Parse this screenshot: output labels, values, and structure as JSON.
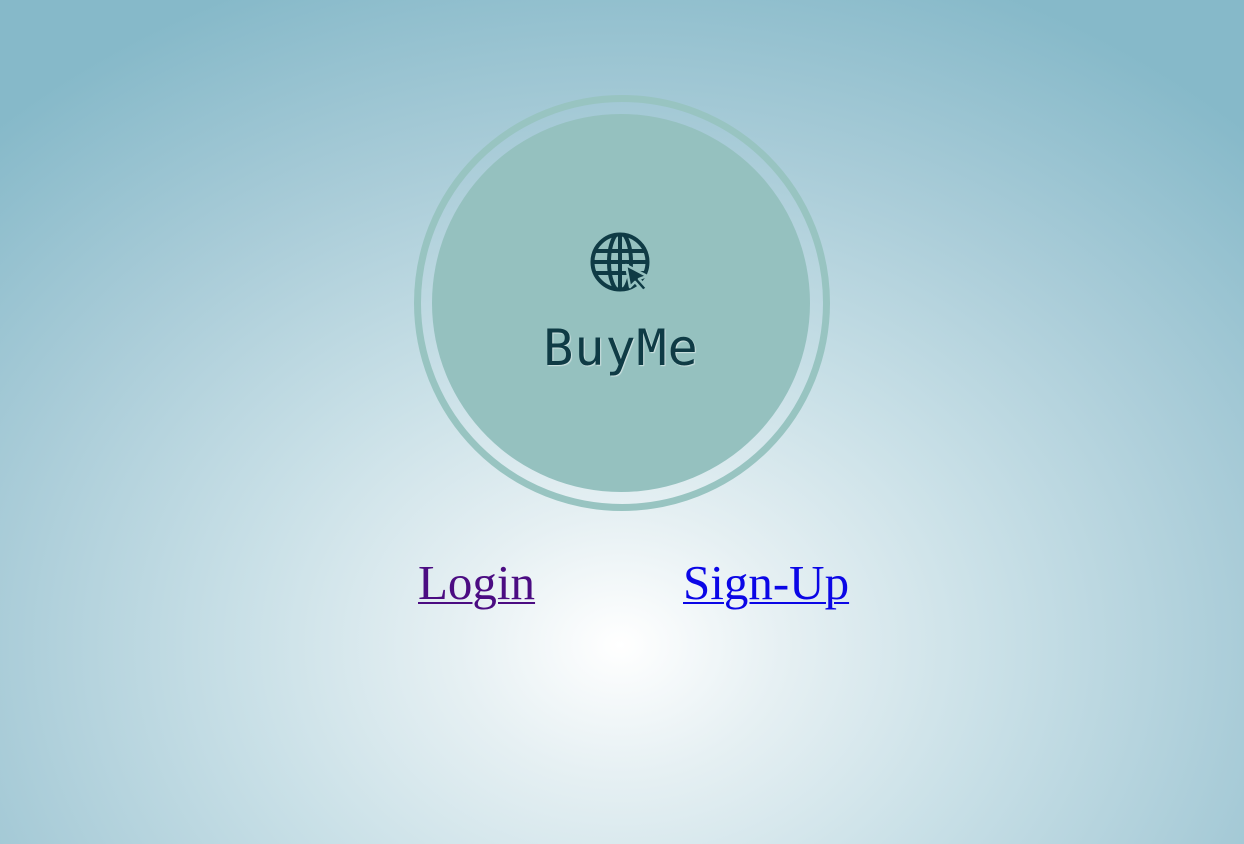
{
  "logo": {
    "icon": "globe-cursor-icon",
    "brand_name": "BuyMe",
    "colors": {
      "ring": "#98c4c1",
      "disc": "#95c1bf",
      "text": "#0f3b45"
    }
  },
  "nav": {
    "login_label": "Login",
    "signup_label": "Sign-Up",
    "colors": {
      "login_visited": "#4b0c82",
      "signup": "#0b06e6"
    }
  }
}
